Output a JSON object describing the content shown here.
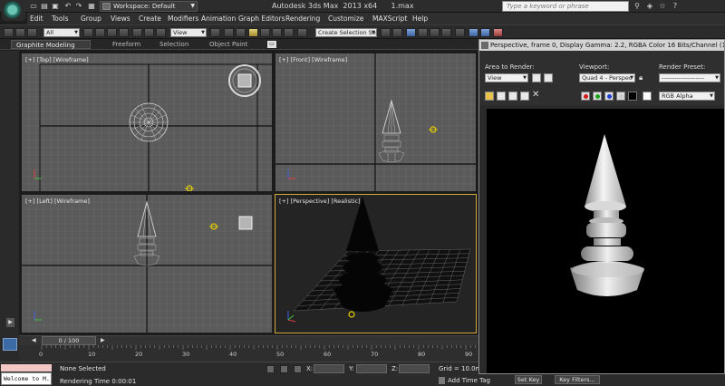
{
  "titlebar": {
    "workspace_label": "Workspace: Default",
    "window_title": "Autodesk 3ds Max  2013 x64      1.max",
    "search_placeholder": "Type a keyword or phrase"
  },
  "menu": {
    "items": [
      "Edit",
      "Tools",
      "Group",
      "Views",
      "Create",
      "Modifiers",
      "Animation",
      "Graph Editors",
      "Rendering",
      "Customize",
      "MAXScript",
      "Help"
    ]
  },
  "toolbar": {
    "selection_filter": "All",
    "reference_coord": "View",
    "named_selection": "Create Selection Se"
  },
  "ribbon": {
    "tabs": [
      "Graphite Modeling Tools",
      "Freeform",
      "Selection",
      "Object Paint"
    ]
  },
  "viewports": {
    "top_label": "[+] [Top] [Wireframe]",
    "front_label": "[+] [Front] [Wireframe]",
    "left_label": "[+] [Left] [Wireframe]",
    "perspective_label": "[+] [Perspective] [Realistic]"
  },
  "timeline": {
    "slider_label": "0 / 100",
    "ticks": [
      "0",
      "10",
      "20",
      "30",
      "40",
      "50",
      "60",
      "70",
      "80",
      "90"
    ]
  },
  "status": {
    "listener_text": "Welcome to M.",
    "selection": "None Selected",
    "rendering_time": "Rendering Time  0:00:01",
    "x_label": "X:",
    "y_label": "Y:",
    "z_label": "Z:",
    "grid": "Grid = 10.0m",
    "add_time_tag": "Add Time Tag",
    "set_key": "Set Key",
    "key_filters": "Key Filters..."
  },
  "render_window": {
    "title": "Perspective, frame 0, Display Gamma: 2.2, RGBA Color 16 Bits/Channel (1:1)",
    "area_label": "Area to Render:",
    "area_value": "View",
    "viewport_label": "Viewport:",
    "viewport_value": "Quad 4 - Perspec",
    "preset_label": "Render Preset:",
    "preset_value": "--------------------",
    "channel_value": "RGB Alpha",
    "swatch_colors": [
      "#d01818",
      "#1aa31a",
      "#1f3fd0",
      "#cccccc"
    ]
  }
}
